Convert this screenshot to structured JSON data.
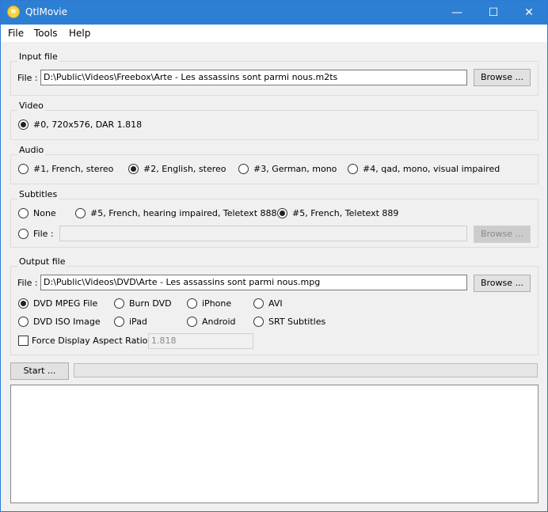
{
  "window": {
    "title": "QtlMovie",
    "icon": "app-icon",
    "minimize": "—",
    "maximize": "☐",
    "close": "✕"
  },
  "menu": {
    "file": "File",
    "tools": "Tools",
    "help": "Help"
  },
  "input_file": {
    "title": "Input file",
    "file_label": "File :",
    "path": "D:\\Public\\Videos\\Freebox\\Arte - Les assassins sont parmi nous.m2ts",
    "browse": "Browse ..."
  },
  "video": {
    "title": "Video",
    "options": [
      {
        "label": "#0, 720x576, DAR 1.818",
        "selected": true
      }
    ]
  },
  "audio": {
    "title": "Audio",
    "options": [
      {
        "label": "#1, French, stereo",
        "selected": false
      },
      {
        "label": "#2, English, stereo",
        "selected": true
      },
      {
        "label": "#3, German, mono",
        "selected": false
      },
      {
        "label": "#4, qad, mono, visual impaired",
        "selected": false
      }
    ]
  },
  "subtitles": {
    "title": "Subtitles",
    "options": [
      {
        "label": "None",
        "selected": false
      },
      {
        "label": "#5, French, hearing impaired, Teletext 888",
        "selected": false
      },
      {
        "label": "#5, French, Teletext 889",
        "selected": true
      },
      {
        "label": "File :",
        "selected": false
      }
    ],
    "file_value": "",
    "browse": "Browse ..."
  },
  "output_file": {
    "title": "Output file",
    "file_label": "File :",
    "path": "D:\\Public\\Videos\\DVD\\Arte - Les assassins sont parmi nous.mpg",
    "browse": "Browse ...",
    "formats": [
      {
        "label": "DVD MPEG File",
        "selected": true
      },
      {
        "label": "Burn DVD",
        "selected": false
      },
      {
        "label": "iPhone",
        "selected": false
      },
      {
        "label": "AVI",
        "selected": false
      },
      {
        "label": "DVD ISO Image",
        "selected": false
      },
      {
        "label": "iPad",
        "selected": false
      },
      {
        "label": "Android",
        "selected": false
      },
      {
        "label": "SRT Subtitles",
        "selected": false
      }
    ],
    "force_dar": {
      "label": "Force Display Aspect Ratio :",
      "checked": false,
      "value": "1.818"
    }
  },
  "start": {
    "label": "Start ..."
  },
  "progress": {
    "value": 0
  },
  "log": {
    "text": ""
  }
}
